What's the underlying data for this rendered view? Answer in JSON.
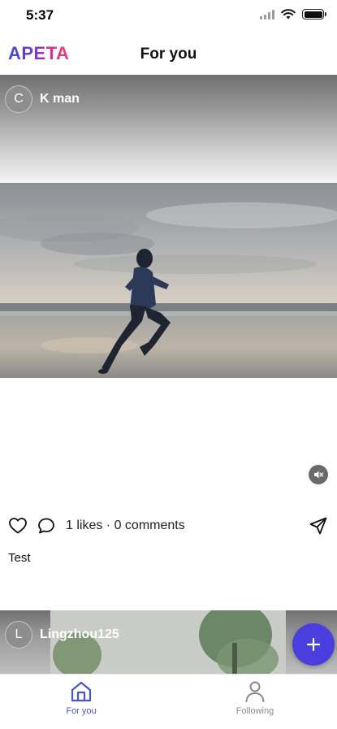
{
  "status_bar": {
    "time": "5:37"
  },
  "header": {
    "logo": "APETA",
    "title": "For you"
  },
  "post": {
    "author_initial": "C",
    "author_name": "K man",
    "stats": "1 likes · 0 comments",
    "caption": "Test"
  },
  "next_post": {
    "author_initial": "L",
    "author_name": "Lingzhou125"
  },
  "icons": {
    "like": "heart-icon",
    "comment": "comment-icon",
    "share": "send-icon",
    "mute": "speaker-muted-icon",
    "fab": "plus-icon"
  },
  "tabs": [
    {
      "label": "For you",
      "icon": "home-icon",
      "active": true
    },
    {
      "label": "Following",
      "icon": "person-icon",
      "active": false
    }
  ],
  "colors": {
    "accent": "#4a3fdc",
    "active_tab": "#4a55c8",
    "inactive_tab": "#8a8a8a"
  }
}
